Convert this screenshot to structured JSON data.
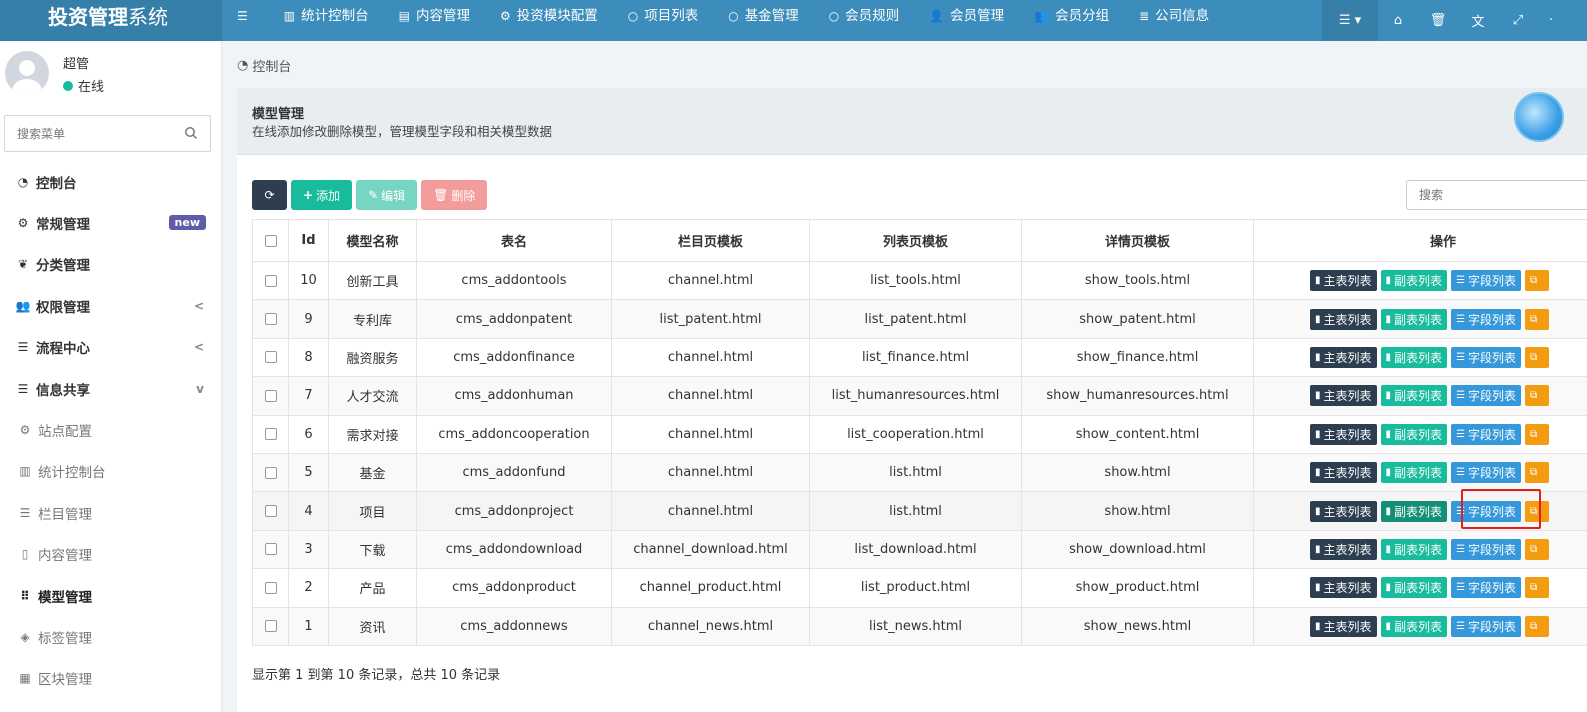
{
  "header": {
    "logo_bold": "投资管理",
    "logo_light": "系统",
    "nav": [
      {
        "icon": "bars-icon",
        "label": ""
      },
      {
        "icon": "bar-chart-icon",
        "label": "统计控制台"
      },
      {
        "icon": "file-icon",
        "label": "内容管理"
      },
      {
        "icon": "cogs-icon",
        "label": "投资模块配置"
      },
      {
        "icon": "circle-icon",
        "label": "项目列表"
      },
      {
        "icon": "circle-icon",
        "label": "基金管理"
      },
      {
        "icon": "circle-icon",
        "label": "会员规则"
      },
      {
        "icon": "user-icon",
        "label": "会员管理"
      },
      {
        "icon": "users-icon",
        "label": "会员分组"
      },
      {
        "icon": "list-icon",
        "label": "公司信息"
      }
    ],
    "right_icons": [
      "menu-dropdown-icon",
      "home-icon",
      "trash-icon",
      "translate-icon",
      "fullscreen-icon"
    ]
  },
  "sidebar": {
    "user_name": "超管",
    "user_status": "在线",
    "search_placeholder": "搜索菜单",
    "items": [
      {
        "icon": "dashboard-icon",
        "label": "控制台"
      },
      {
        "icon": "cogs-icon",
        "label": "常规管理",
        "badge": "new"
      },
      {
        "icon": "leaf-icon",
        "label": "分类管理"
      },
      {
        "icon": "group-icon",
        "label": "权限管理",
        "arrow": "<"
      },
      {
        "icon": "list-icon",
        "label": "流程中心",
        "arrow": "<"
      },
      {
        "icon": "list-icon",
        "label": "信息共享",
        "arrow": "v"
      },
      {
        "icon": "cogs-icon",
        "label": "站点配置"
      },
      {
        "icon": "bar-chart-icon",
        "label": "统计控制台"
      },
      {
        "icon": "list-icon",
        "label": "栏目管理"
      },
      {
        "icon": "file-icon",
        "label": "内容管理"
      },
      {
        "icon": "th-icon",
        "label": "模型管理"
      },
      {
        "icon": "tags-icon",
        "label": "标签管理"
      },
      {
        "icon": "th-large-icon",
        "label": "区块管理"
      }
    ]
  },
  "breadcrumb": "控制台",
  "panel": {
    "title": "模型管理",
    "description": "在线添加修改删除模型，管理模型字段和相关模型数据"
  },
  "toolbar": {
    "add": "添加",
    "edit": "编辑",
    "delete": "删除",
    "search_placeholder": "搜索"
  },
  "table": {
    "columns": [
      "",
      "Id",
      "模型名称",
      "表名",
      "栏目页模板",
      "列表页模板",
      "详情页模板",
      "操作"
    ],
    "op_labels": {
      "main": "主表列表",
      "sub": "副表列表",
      "field": "字段列表"
    },
    "rows": [
      {
        "id": "10",
        "name": "创新工具",
        "table": "cms_addontools",
        "channel": "channel.html",
        "list": "list_tools.html",
        "show": "show_tools.html"
      },
      {
        "id": "9",
        "name": "专利库",
        "table": "cms_addonpatent",
        "channel": "list_patent.html",
        "list": "list_patent.html",
        "show": "show_patent.html"
      },
      {
        "id": "8",
        "name": "融资服务",
        "table": "cms_addonfinance",
        "channel": "channel.html",
        "list": "list_finance.html",
        "show": "show_finance.html"
      },
      {
        "id": "7",
        "name": "人才交流",
        "table": "cms_addonhuman",
        "channel": "channel.html",
        "list": "list_humanresources.html",
        "show": "show_humanresources.html"
      },
      {
        "id": "6",
        "name": "需求对接",
        "table": "cms_addoncooperation",
        "channel": "channel.html",
        "list": "list_cooperation.html",
        "show": "show_content.html"
      },
      {
        "id": "5",
        "name": "基金",
        "table": "cms_addonfund",
        "channel": "channel.html",
        "list": "list.html",
        "show": "show.html"
      },
      {
        "id": "4",
        "name": "项目",
        "table": "cms_addonproject",
        "channel": "channel.html",
        "list": "list.html",
        "show": "show.html"
      },
      {
        "id": "3",
        "name": "下载",
        "table": "cms_addondownload",
        "channel": "channel_download.html",
        "list": "list_download.html",
        "show": "show_download.html"
      },
      {
        "id": "2",
        "name": "产品",
        "table": "cms_addonproduct",
        "channel": "channel_product.html",
        "list": "list_product.html",
        "show": "show_product.html"
      },
      {
        "id": "1",
        "name": "资讯",
        "table": "cms_addonnews",
        "channel": "channel_news.html",
        "list": "list_news.html",
        "show": "show_news.html"
      }
    ]
  },
  "footer": "显示第 1 到第 10 条记录，总共 10 条记录",
  "colors": {
    "header": "#3c8dbc",
    "primary_dark": "#2c3e50",
    "success": "#18bc9c",
    "info": "#3498db",
    "warning": "#f39c12"
  }
}
